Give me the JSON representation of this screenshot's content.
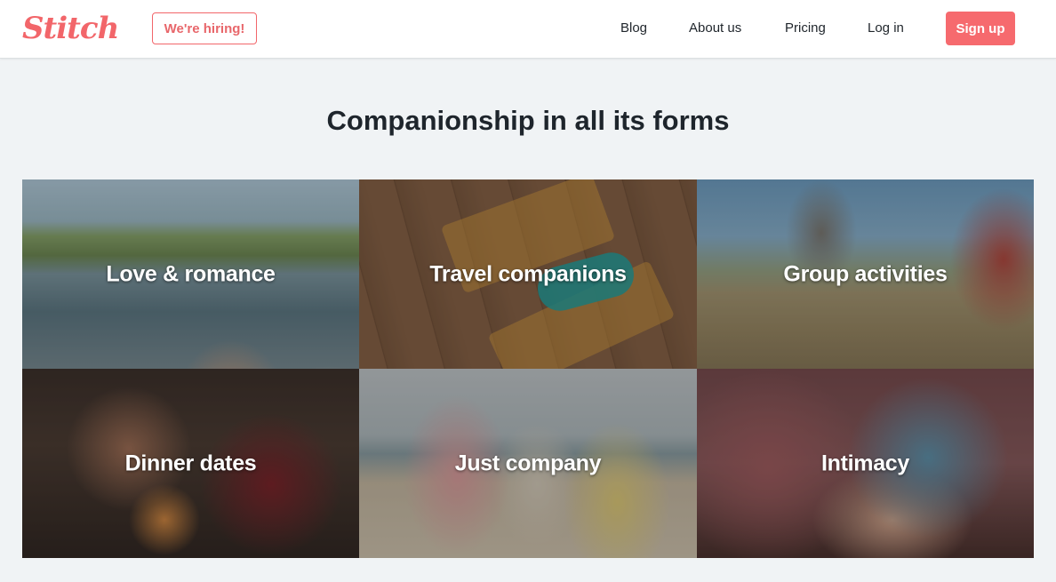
{
  "header": {
    "logo_text": "Stitch",
    "hiring_label": "We're hiring!",
    "nav": {
      "blog": "Blog",
      "about": "About us",
      "pricing": "Pricing",
      "login": "Log in",
      "signup": "Sign up"
    }
  },
  "main": {
    "headline": "Companionship in all its forms",
    "tiles": [
      {
        "label": "Love & romance"
      },
      {
        "label": "Travel companions"
      },
      {
        "label": "Group activities"
      },
      {
        "label": "Dinner dates"
      },
      {
        "label": "Just company"
      },
      {
        "label": "Intimacy"
      }
    ]
  },
  "colors": {
    "brand": "#f2666a",
    "signup_bg": "#f66a6e",
    "page_bg": "#f0f3f5",
    "text_dark": "#1e252c"
  }
}
